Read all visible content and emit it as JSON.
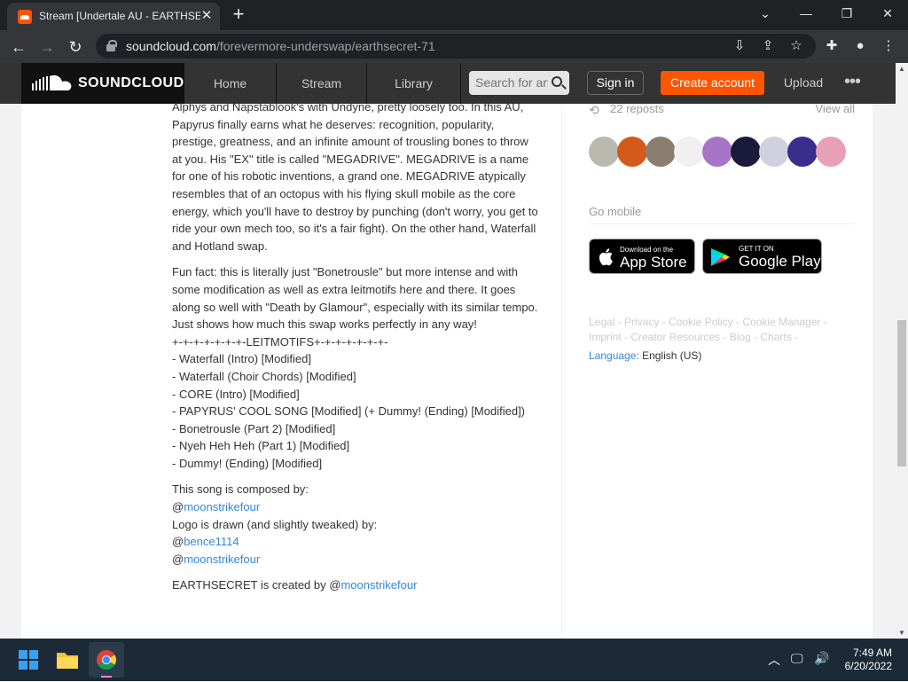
{
  "browser": {
    "tab_title": "Stream [Undertale AU - EARTHSECRET",
    "url_host": "soundcloud.com",
    "url_path": "/forevermore-underswap/earthsecret-71",
    "close_tab": "✕",
    "new_tab": "+",
    "win_min": "⌄",
    "win_min2": "—",
    "win_restore": "❐",
    "win_close": "✕"
  },
  "header": {
    "logo": "SOUNDCLOUD",
    "nav": [
      "Home",
      "Stream",
      "Library"
    ],
    "search_placeholder": "Search for artists",
    "sign_in": "Sign in",
    "create_account": "Create account",
    "upload": "Upload",
    "more": "•••"
  },
  "description": {
    "intro": "Alphys and Napstablook's with Undyne, pretty loosely too. In this AU, Papyrus finally earns what he deserves: recognition, popularity, prestige, greatness, and an infinite amount of trousling bones to throw at you. His \"EX\" title is called \"MEGADRIVE\". MEGADRIVE is a name for one of his robotic inventions, a grand one. MEGADRIVE atypically resembles that of an octopus with his flying skull mobile as the core energy, which you'll have to destroy by punching (don't worry, you get to ride your own mech too, so it's a fair fight). On the other hand, Waterfall and Hotland swap.",
    "funfact": "Fun fact: this is literally just \"Bonetrousle\" but more intense and with some modification as well as extra leitmotifs here and there. It goes along so well with \"Death by Glamour\", especially with its similar tempo. Just shows how much this swap works perfectly in any way!",
    "leit_header": "+-+-+-+-+-+-+-LEITMOTIFS+-+-+-+-+-+-+-",
    "leitmotifs": [
      "- Waterfall (Intro) [Modified]",
      "- Waterfall (Choir Chords) [Modified]",
      "- CORE (Intro) [Modified]",
      "- PAPYRUS' COOL SONG [Modified] (+ Dummy! (Ending) [Modified])",
      "- Bonetrousle (Part 2) [Modified]",
      "- Nyeh Heh Heh (Part 1) [Modified]",
      "- Dummy! (Ending) [Modified]"
    ],
    "composed_by": "This song is composed by:",
    "at": "@",
    "composer": "moonstrikefour",
    "logo_by": "Logo is drawn (and slightly tweaked) by:",
    "logo_artist1": "bence1114",
    "logo_artist2": "moonstrikefour",
    "created_prefix": "EARTHSECRET is created by @",
    "creator": "moonstrikefour"
  },
  "sidebar": {
    "reposts": "22 reposts",
    "view_all": "View all",
    "avatar_colors": [
      "#b9b9b0",
      "#d45a1a",
      "#8a7f6e",
      "#f0f0f0",
      "#a874c8",
      "#1a1a3a",
      "#d0d0e0",
      "#3a2e8c",
      "#e8a0b8"
    ],
    "go_mobile": "Go mobile",
    "app_store_small": "Download on the",
    "app_store_big": "App Store",
    "google_small": "GET IT ON",
    "google_big": "Google Play",
    "footer_line1": "Legal - Privacy - Cookie Policy - Cookie Manager -",
    "footer_line2": "Imprint - Creator Resources - Blog - Charts -",
    "language_label": "Language:",
    "language_value": "English (US)"
  },
  "taskbar": {
    "time": "7:49 AM",
    "date": "6/20/2022"
  }
}
